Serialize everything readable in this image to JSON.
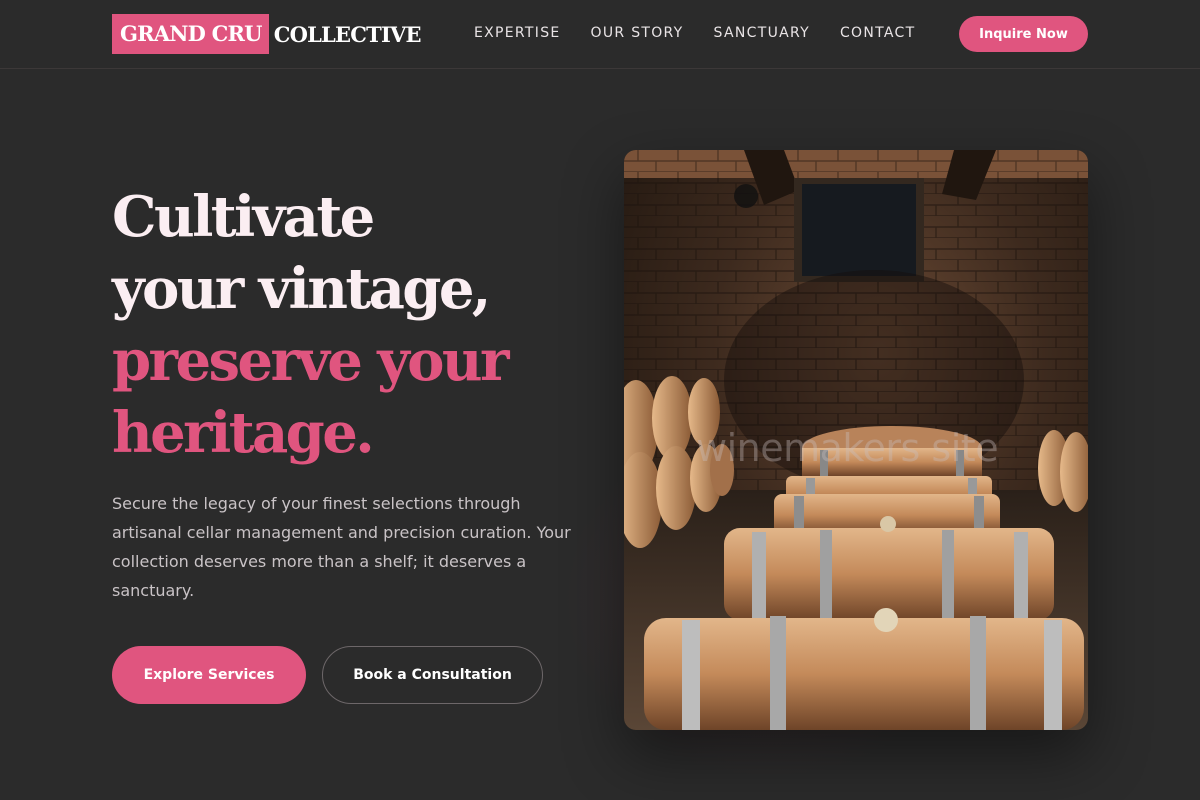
{
  "header": {
    "logo_highlight": "GRAND CRU",
    "logo_rest": "COLLECTIVE",
    "nav": [
      {
        "label": "EXPERTISE"
      },
      {
        "label": "OUR STORY"
      },
      {
        "label": "SANCTUARY"
      },
      {
        "label": "CONTACT"
      }
    ],
    "cta_label": "Inquire Now"
  },
  "hero": {
    "title_lines": [
      "Cultivate",
      "your vintage,",
      "preserve your",
      "heritage."
    ],
    "description": "Secure the legacy of your finest selections through artisanal cellar management and precision curation. Your collection deserves more than a shelf; it deserves a sanctuary.",
    "primary_button": "Explore Services",
    "secondary_button": "Book a Consultation",
    "image_watermark": "winemakers site"
  },
  "colors": {
    "background": "#2b2b2b",
    "accent": "#e0557f",
    "title_light": "#fbeef2",
    "body_text": "#c9c3c6"
  }
}
